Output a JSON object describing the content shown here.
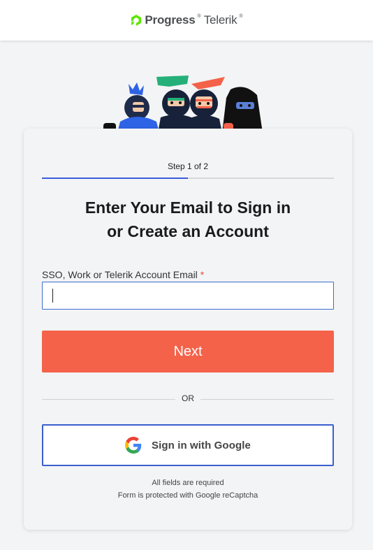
{
  "brand": {
    "name_bold": "Progress",
    "name_light": "Telerik",
    "trademark": "®",
    "accent_color": "#5ce500"
  },
  "step": {
    "label": "Step 1 of 2",
    "current": 1,
    "total": 2
  },
  "heading": {
    "line1": "Enter Your Email to Sign in",
    "line2": "or Create an Account"
  },
  "email_field": {
    "label": "SSO, Work or Telerik Account Email",
    "required_marker": "*",
    "value": "",
    "placeholder": ""
  },
  "actions": {
    "next_label": "Next",
    "next_color": "#f4624a",
    "divider_text": "OR",
    "google_label": "Sign in with Google",
    "google_border_color": "#3a5fcd"
  },
  "footer": {
    "required_note": "All fields are required",
    "recaptcha_note": "Form is protected with Google reCaptcha"
  },
  "icons": {
    "logo": "progress-logo-icon",
    "illustration": "ninja-team-illustration",
    "google": "google-g-icon"
  }
}
